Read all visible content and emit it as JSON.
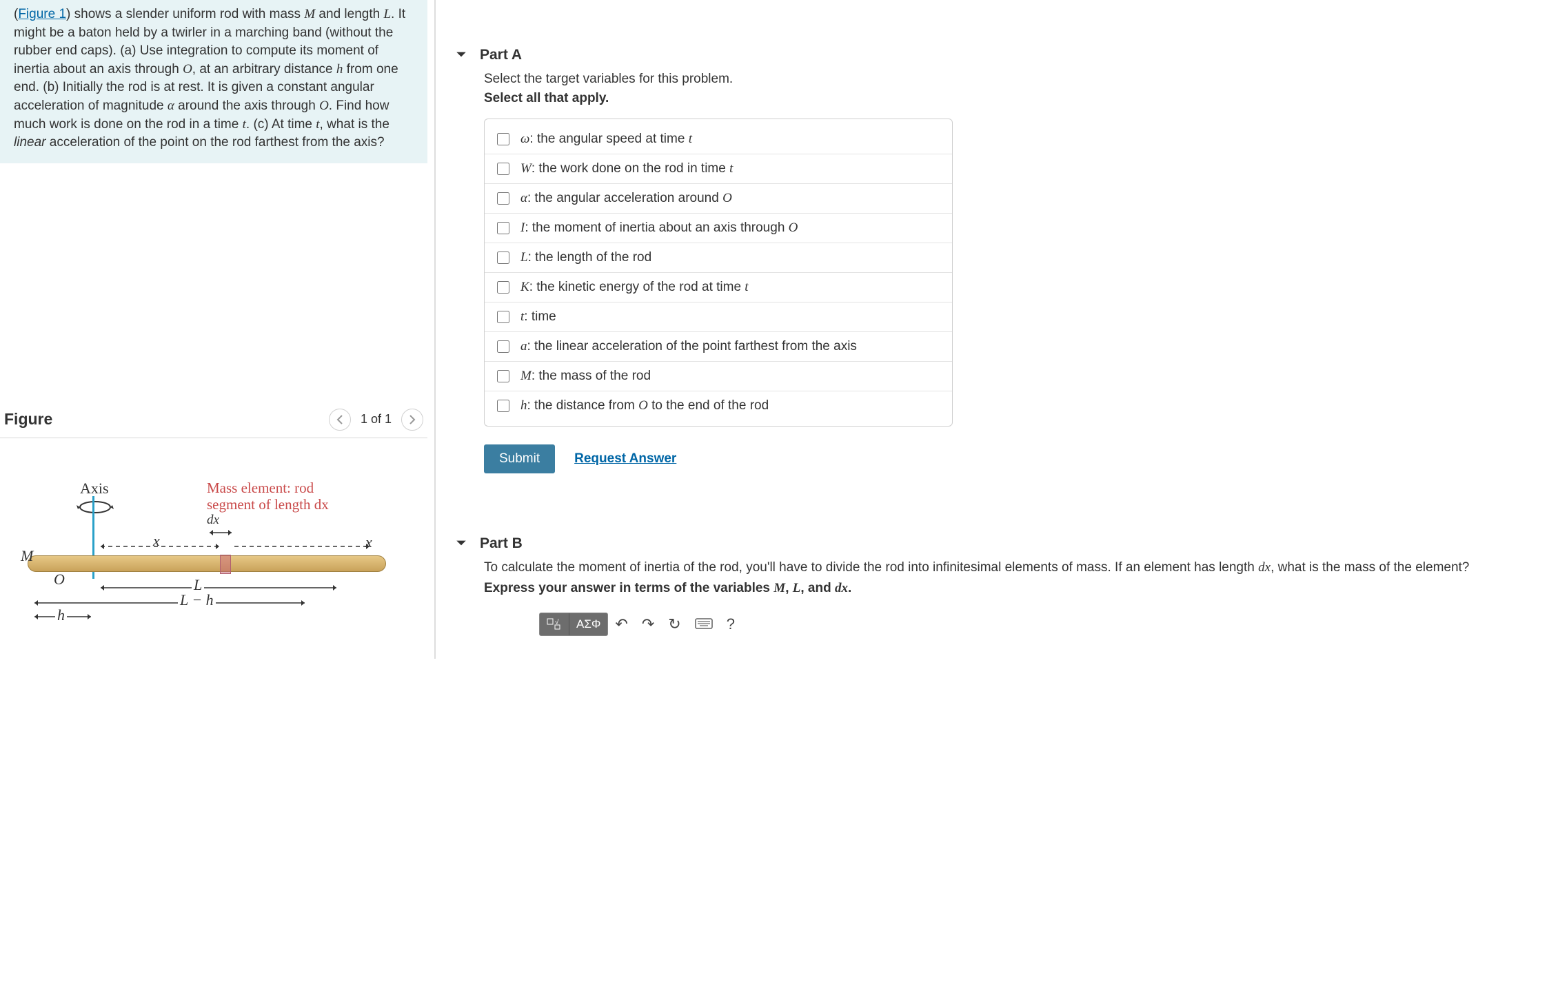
{
  "problem": {
    "figure_link": "Figure 1",
    "text_before": "(",
    "text_1": ") shows a slender uniform rod with mass ",
    "var_M": "M",
    "text_2": " and length ",
    "var_L": "L",
    "text_3": ". It might be a baton held by a twirler in a marching band (without the rubber end caps). (a) Use integration to compute its moment of inertia about an axis through ",
    "var_O": "O",
    "text_4": ", at an arbitrary distance ",
    "var_h": "h",
    "text_5": " from one end. (b) Initially the rod is at rest. It is given a constant angular acceleration of magnitude ",
    "var_alpha": "α",
    "text_6": " around the axis through ",
    "var_O2": "O",
    "text_7": ". Find how much work is done on the rod in a time ",
    "var_t": "t",
    "text_8": ". (c) At time ",
    "var_t2": "t",
    "text_9": ", what is the ",
    "linear_word": "linear",
    "text_10": " acceleration of the point on the rod farthest from the axis?"
  },
  "figure": {
    "title": "Figure",
    "counter": "1 of 1",
    "axis_label": "Axis",
    "M_label": "M",
    "O_label": "O",
    "x_label_left": "x",
    "x_label_right": "x",
    "h_label": "h",
    "L_label": "L",
    "Lmh_label": "L − h",
    "dx_label": "dx",
    "mass_element_l1": "Mass element: rod",
    "mass_element_l2": "segment of length dx"
  },
  "partA": {
    "title": "Part A",
    "instruction": "Select the target variables for this problem.",
    "sub_instruction": "Select all that apply.",
    "options": [
      {
        "sym": "ω",
        "text": ": the angular speed at time ",
        "tail": "t"
      },
      {
        "sym": "W",
        "text": ": the work done on the rod in time ",
        "tail": "t"
      },
      {
        "sym": "α",
        "text": ": the angular acceleration around ",
        "tail": "O"
      },
      {
        "sym": "I",
        "text": ": the moment of inertia about an axis through ",
        "tail": "O"
      },
      {
        "sym": "L",
        "text": ": the length of the rod",
        "tail": ""
      },
      {
        "sym": "K",
        "text": ": the kinetic energy of the rod at time ",
        "tail": "t"
      },
      {
        "sym": "t",
        "text": ": time",
        "tail": ""
      },
      {
        "sym": "a",
        "text": ": the linear acceleration of the point farthest from the axis",
        "tail": ""
      },
      {
        "sym": "M",
        "text": ": the mass of the rod",
        "tail": ""
      },
      {
        "sym": "h",
        "text": ": the distance from ",
        "mid": "O",
        "tail2": " to the end of the rod"
      }
    ],
    "submit": "Submit",
    "request": "Request Answer"
  },
  "partB": {
    "title": "Part B",
    "text_1": "To calculate the moment of inertia of the rod, you'll have to divide the rod into infinitesimal elements of mass. If an element has length ",
    "var_dx": "dx",
    "text_2": ", what is the mass of the element?",
    "express_1": "Express your answer in terms of the variables ",
    "e_M": "M",
    "e_sep1": ", ",
    "e_L": "L",
    "e_sep2": ", and ",
    "e_dx": "dx",
    "e_end": ".",
    "toolbar": {
      "greek": "ΑΣΦ",
      "help": "?"
    }
  }
}
